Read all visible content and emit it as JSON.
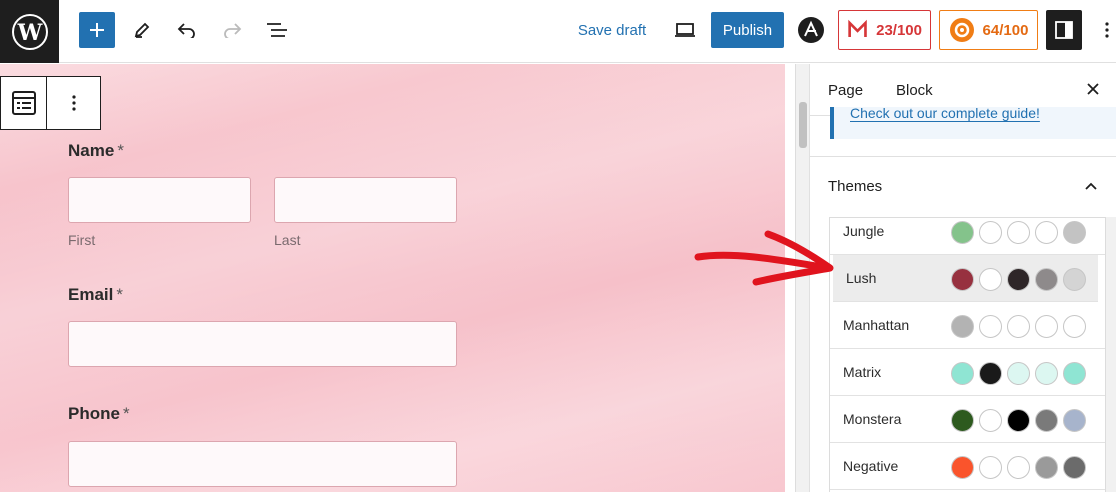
{
  "topbar": {
    "save_draft": "Save draft",
    "publish": "Publish",
    "score_a": "23/100",
    "score_b": "64/100",
    "icons": [
      "wordpress-logo",
      "plus-icon",
      "pencil-icon",
      "undo-icon",
      "redo-icon",
      "list-view-icon",
      "preview-device-icon",
      "a-icon",
      "m-icon",
      "gear-icon",
      "sidebar-icon"
    ]
  },
  "form": {
    "name_label": "Name",
    "required_marker": "*",
    "first_label": "First",
    "last_label": "Last",
    "email_label": "Email",
    "phone_label": "Phone"
  },
  "sidebar": {
    "tab_page": "Page",
    "tab_block": "Block",
    "notice_link": "Check out our complete guide!",
    "themes_title": "Themes",
    "themes": [
      {
        "name": "Jungle",
        "colors": [
          "#84c38b",
          "#ffffff",
          "#ffffff",
          "#ffffff",
          "#c3c3c3"
        ]
      },
      {
        "name": "Lush",
        "colors": [
          "#97313f",
          "#ffffff",
          "#2e2628",
          "#8e8a8b",
          "#d4d4d4"
        ],
        "selected": true
      },
      {
        "name": "Manhattan",
        "colors": [
          "#b3b3b3",
          "#ffffff",
          "#ffffff",
          "#ffffff",
          "#ffffff"
        ]
      },
      {
        "name": "Matrix",
        "colors": [
          "#8fe5d3",
          "#1a1a1a",
          "#dcf7f1",
          "#dcf7f1",
          "#8fe5d3"
        ]
      },
      {
        "name": "Monstera",
        "colors": [
          "#2d5a1e",
          "#ffffff",
          "#000000",
          "#7a7a7a",
          "#a7b4cc"
        ]
      },
      {
        "name": "Negative",
        "colors": [
          "#fa542c",
          "#ffffff",
          "#ffffff",
          "#9a9a9a",
          "#6b6b6b"
        ]
      }
    ]
  },
  "colors": {
    "accent": "#2271b1",
    "annotation_arrow": "#e0141e"
  }
}
